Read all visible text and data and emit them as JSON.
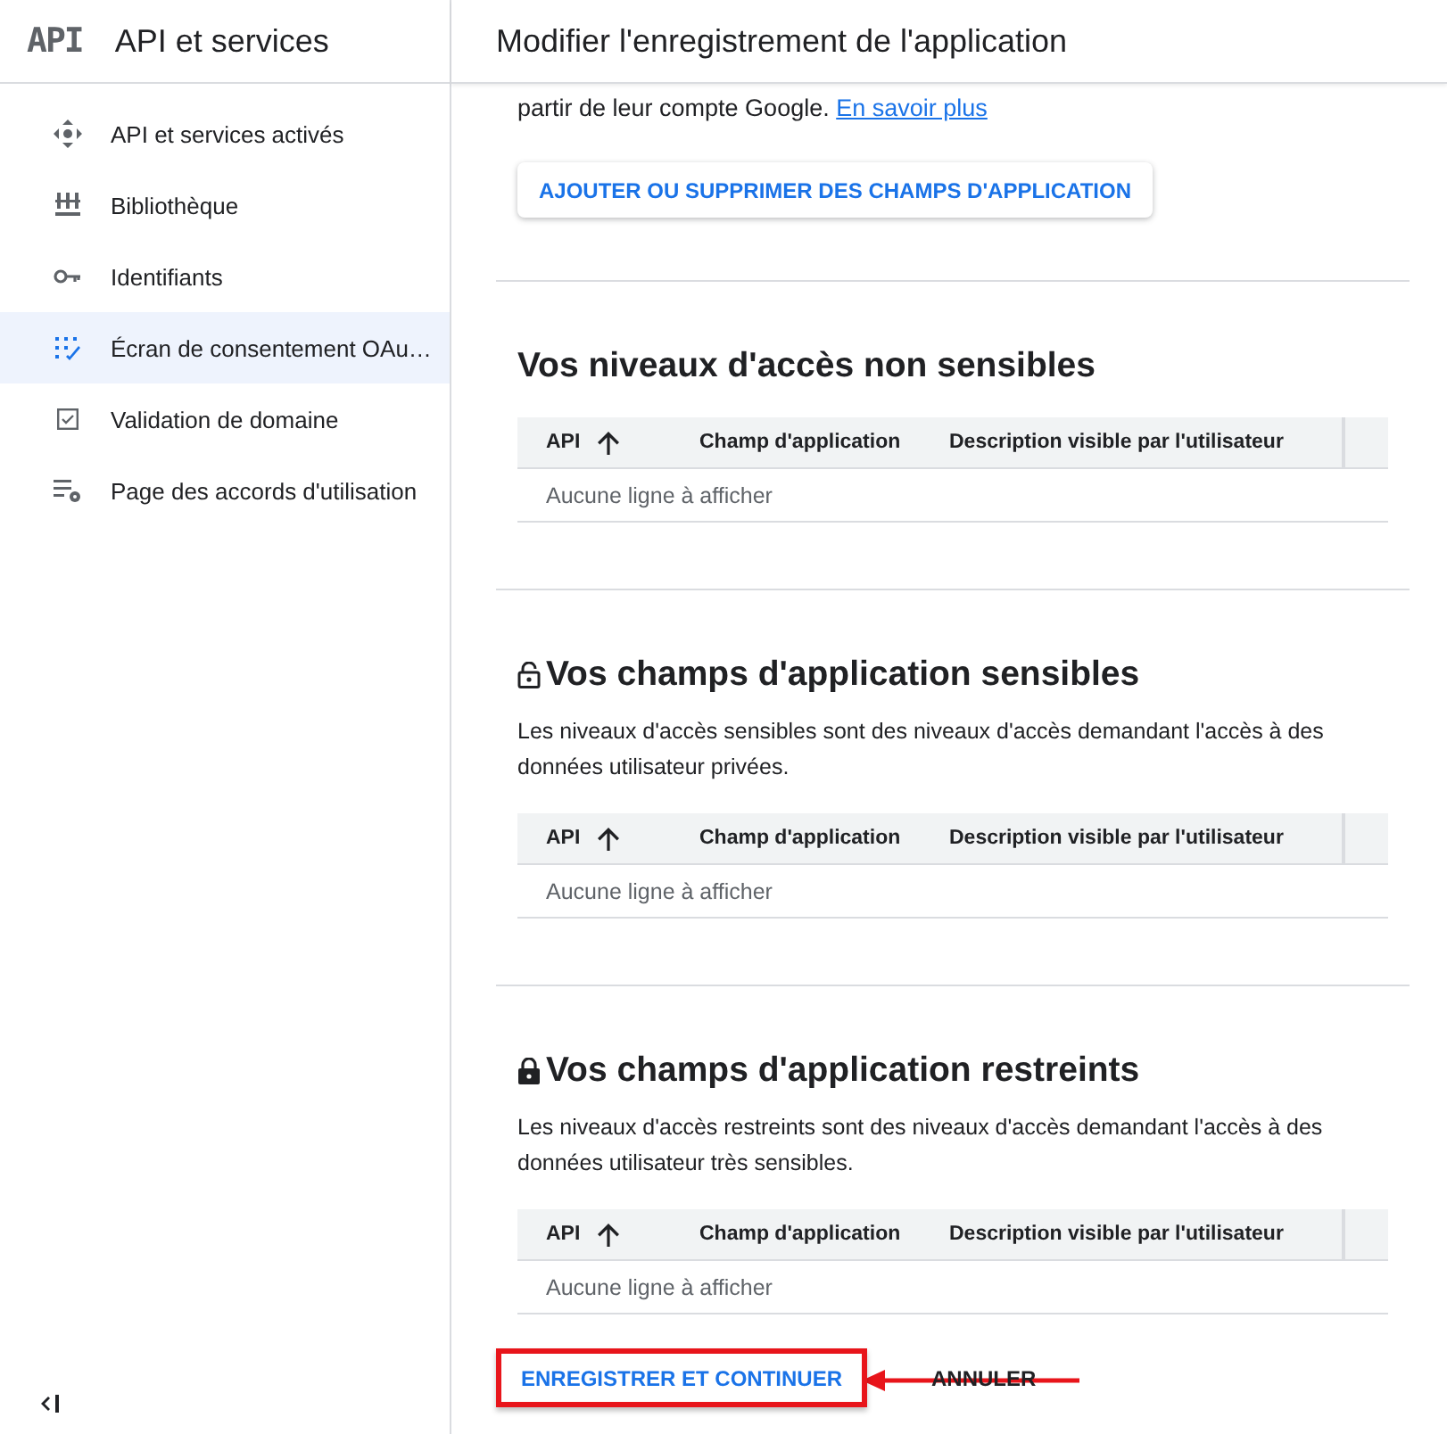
{
  "sidebar": {
    "logo": "API",
    "title": "API et services",
    "items": [
      {
        "label": "API et services activés",
        "selected": false
      },
      {
        "label": "Bibliothèque",
        "selected": false
      },
      {
        "label": "Identifiants",
        "selected": false
      },
      {
        "label": "Écran de consentement OAu…",
        "selected": true
      },
      {
        "label": "Validation de domaine",
        "selected": false
      },
      {
        "label": "Page des accords d'utilisation",
        "selected": false
      }
    ]
  },
  "main": {
    "title": "Modifier l'enregistrement de l'application",
    "intro": {
      "text": "partir de leur compte Google.",
      "link": "En savoir plus"
    },
    "scope_button": "AJOUTER OU SUPPRIMER DES CHAMPS D'APPLICATION",
    "sections": [
      {
        "title": "Vos niveaux d'accès non sensibles",
        "kind": "plain",
        "columns": [
          {
            "label": "API",
            "sorted": true
          },
          {
            "label": "Champ d'application",
            "sorted": false
          },
          {
            "label": "Description visible par l'utilisateur",
            "sorted": false
          }
        ],
        "empty": "Aucune ligne à afficher"
      },
      {
        "title": "Vos champs d'application sensibles",
        "kind": "sensitive",
        "description": "Les niveaux d'accès sensibles sont des niveaux d'accès demandant l'accès à des données utilisateur privées.",
        "columns": [
          {
            "label": "API",
            "sorted": true
          },
          {
            "label": "Champ d'application",
            "sorted": false
          },
          {
            "label": "Description visible par l'utilisateur",
            "sorted": false
          }
        ],
        "empty": "Aucune ligne à afficher"
      },
      {
        "title": "Vos champs d'application restreints",
        "kind": "restricted",
        "description": "Les niveaux d'accès restreints sont des niveaux d'accès demandant l'accès à des données utilisateur très sensibles.",
        "columns": [
          {
            "label": "API",
            "sorted": true
          },
          {
            "label": "Champ d'application",
            "sorted": false
          },
          {
            "label": "Description visible par l'utilisateur",
            "sorted": false
          }
        ],
        "empty": "Aucune ligne à afficher"
      }
    ],
    "actions": [
      {
        "label": "ENREGISTRER ET CONTINUER",
        "kind": "primary",
        "highlighted": true
      },
      {
        "label": "ANNULER",
        "kind": "text",
        "highlighted": false
      }
    ],
    "annotation": {
      "kind": "arrow"
    }
  }
}
